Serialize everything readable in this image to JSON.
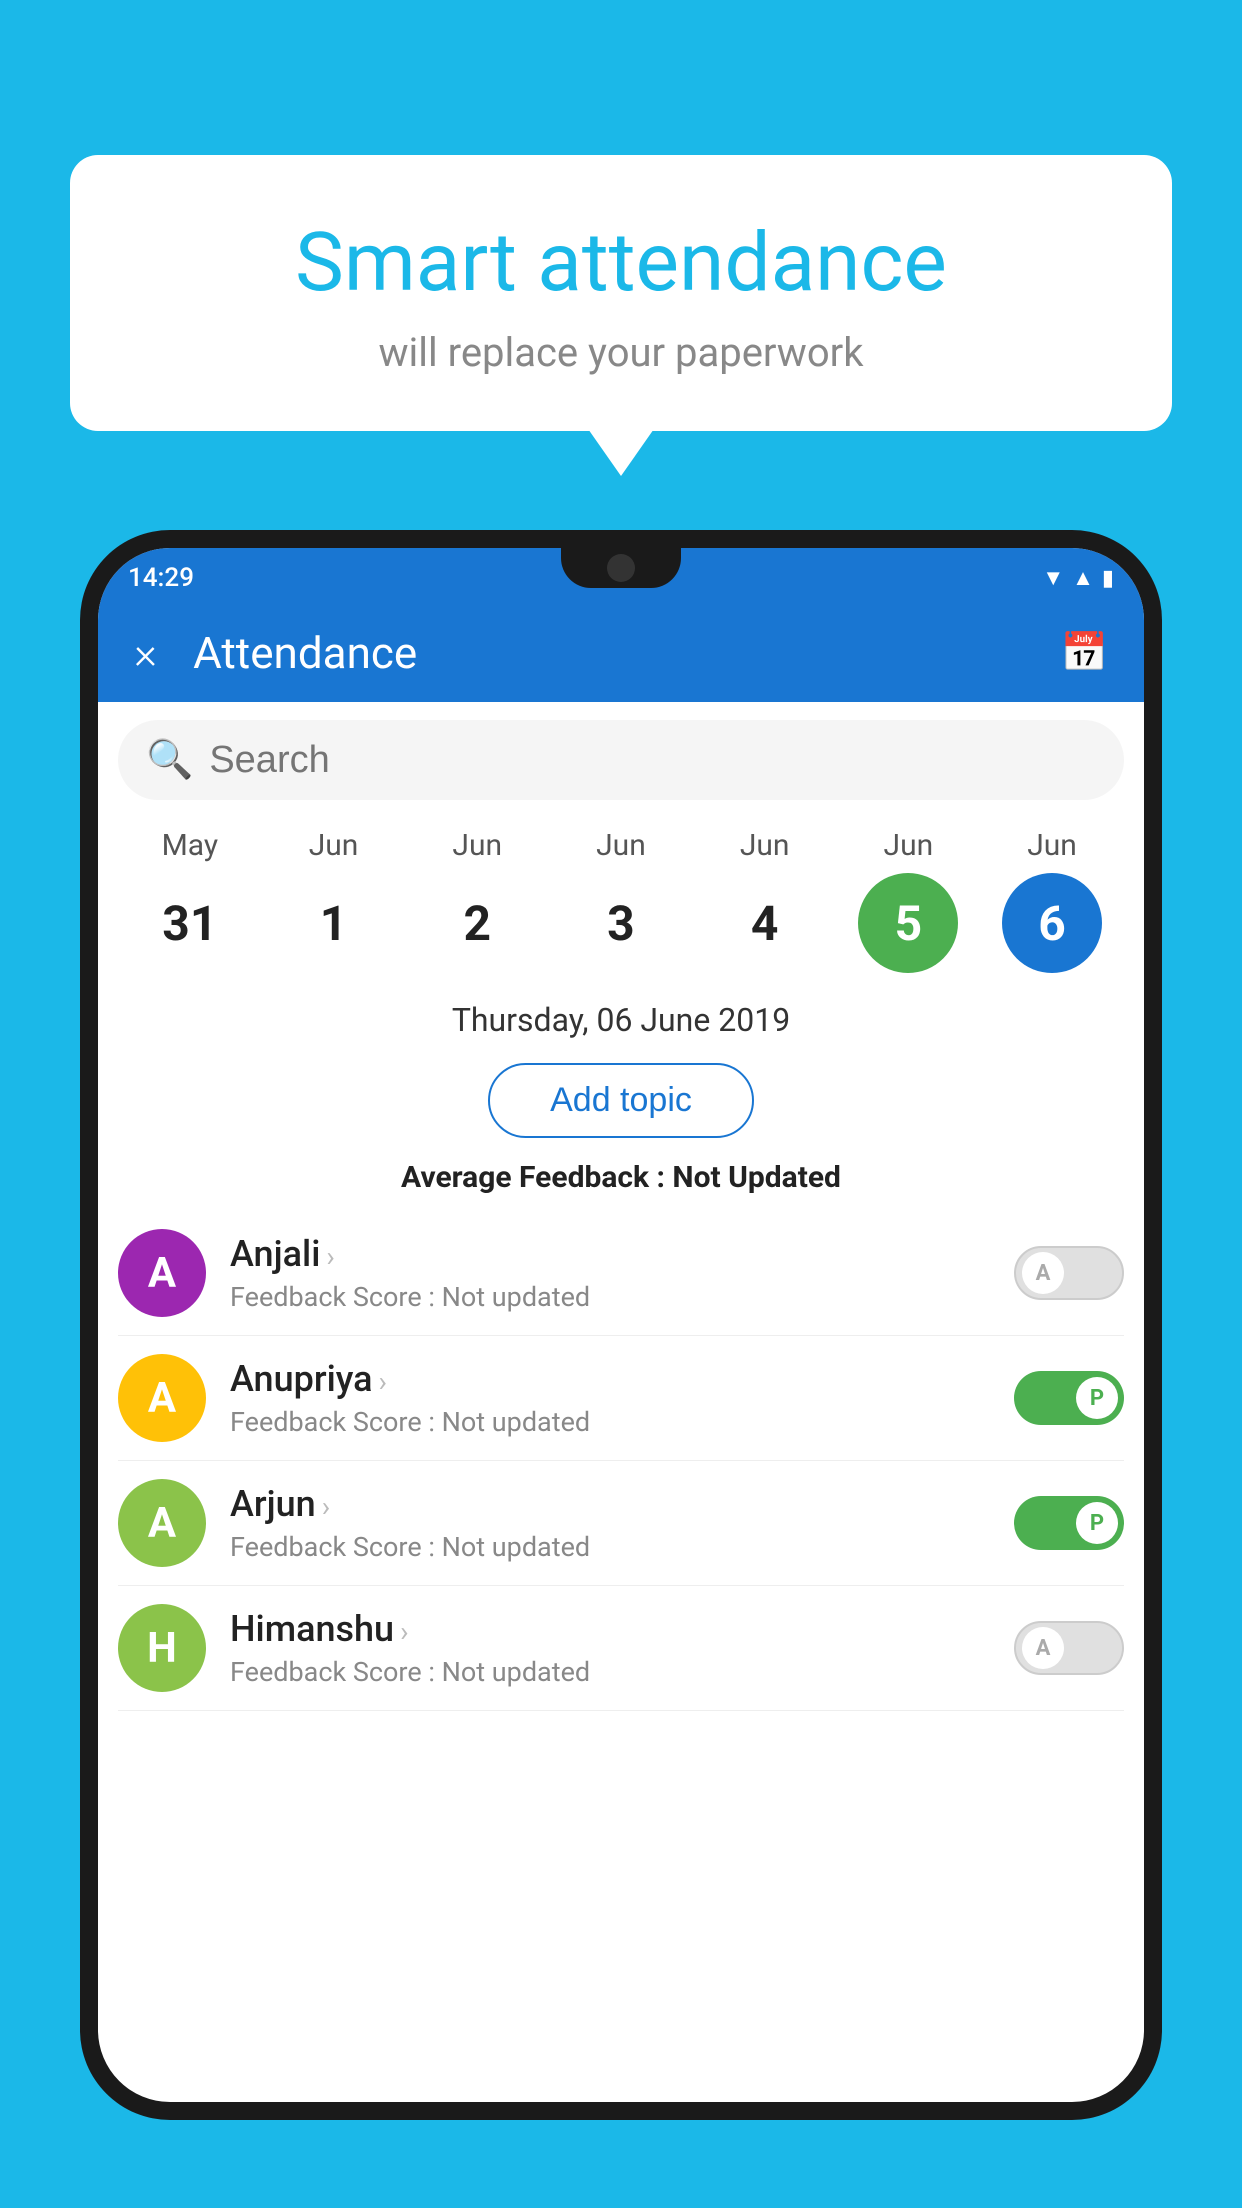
{
  "background_color": "#1BB8E8",
  "speech_bubble": {
    "title": "Smart attendance",
    "subtitle": "will replace your paperwork"
  },
  "status_bar": {
    "time": "14:29",
    "icons": [
      "wifi",
      "signal",
      "battery"
    ]
  },
  "app_bar": {
    "title": "Attendance",
    "close_label": "×",
    "calendar_icon": "📅"
  },
  "search": {
    "placeholder": "Search"
  },
  "dates": [
    {
      "month": "May",
      "day": "31",
      "state": "normal"
    },
    {
      "month": "Jun",
      "day": "1",
      "state": "normal"
    },
    {
      "month": "Jun",
      "day": "2",
      "state": "normal"
    },
    {
      "month": "Jun",
      "day": "3",
      "state": "normal"
    },
    {
      "month": "Jun",
      "day": "4",
      "state": "normal"
    },
    {
      "month": "Jun",
      "day": "5",
      "state": "today"
    },
    {
      "month": "Jun",
      "day": "6",
      "state": "selected"
    }
  ],
  "selected_date": "Thursday, 06 June 2019",
  "add_topic_label": "Add topic",
  "average_feedback": {
    "label": "Average Feedback : ",
    "value": "Not Updated"
  },
  "students": [
    {
      "name": "Anjali",
      "initial": "A",
      "avatar_color": "#9C27B0",
      "score_label": "Feedback Score : ",
      "score_value": "Not updated",
      "toggle_state": "off",
      "toggle_label": "A"
    },
    {
      "name": "Anupriya",
      "initial": "A",
      "avatar_color": "#FFC107",
      "score_label": "Feedback Score : ",
      "score_value": "Not updated",
      "toggle_state": "on",
      "toggle_label": "P"
    },
    {
      "name": "Arjun",
      "initial": "A",
      "avatar_color": "#8BC34A",
      "score_label": "Feedback Score : ",
      "score_value": "Not updated",
      "toggle_state": "on",
      "toggle_label": "P"
    },
    {
      "name": "Himanshu",
      "initial": "H",
      "avatar_color": "#8BC34A",
      "score_label": "Feedback Score : ",
      "score_value": "Not updated",
      "toggle_state": "off",
      "toggle_label": "A"
    }
  ]
}
